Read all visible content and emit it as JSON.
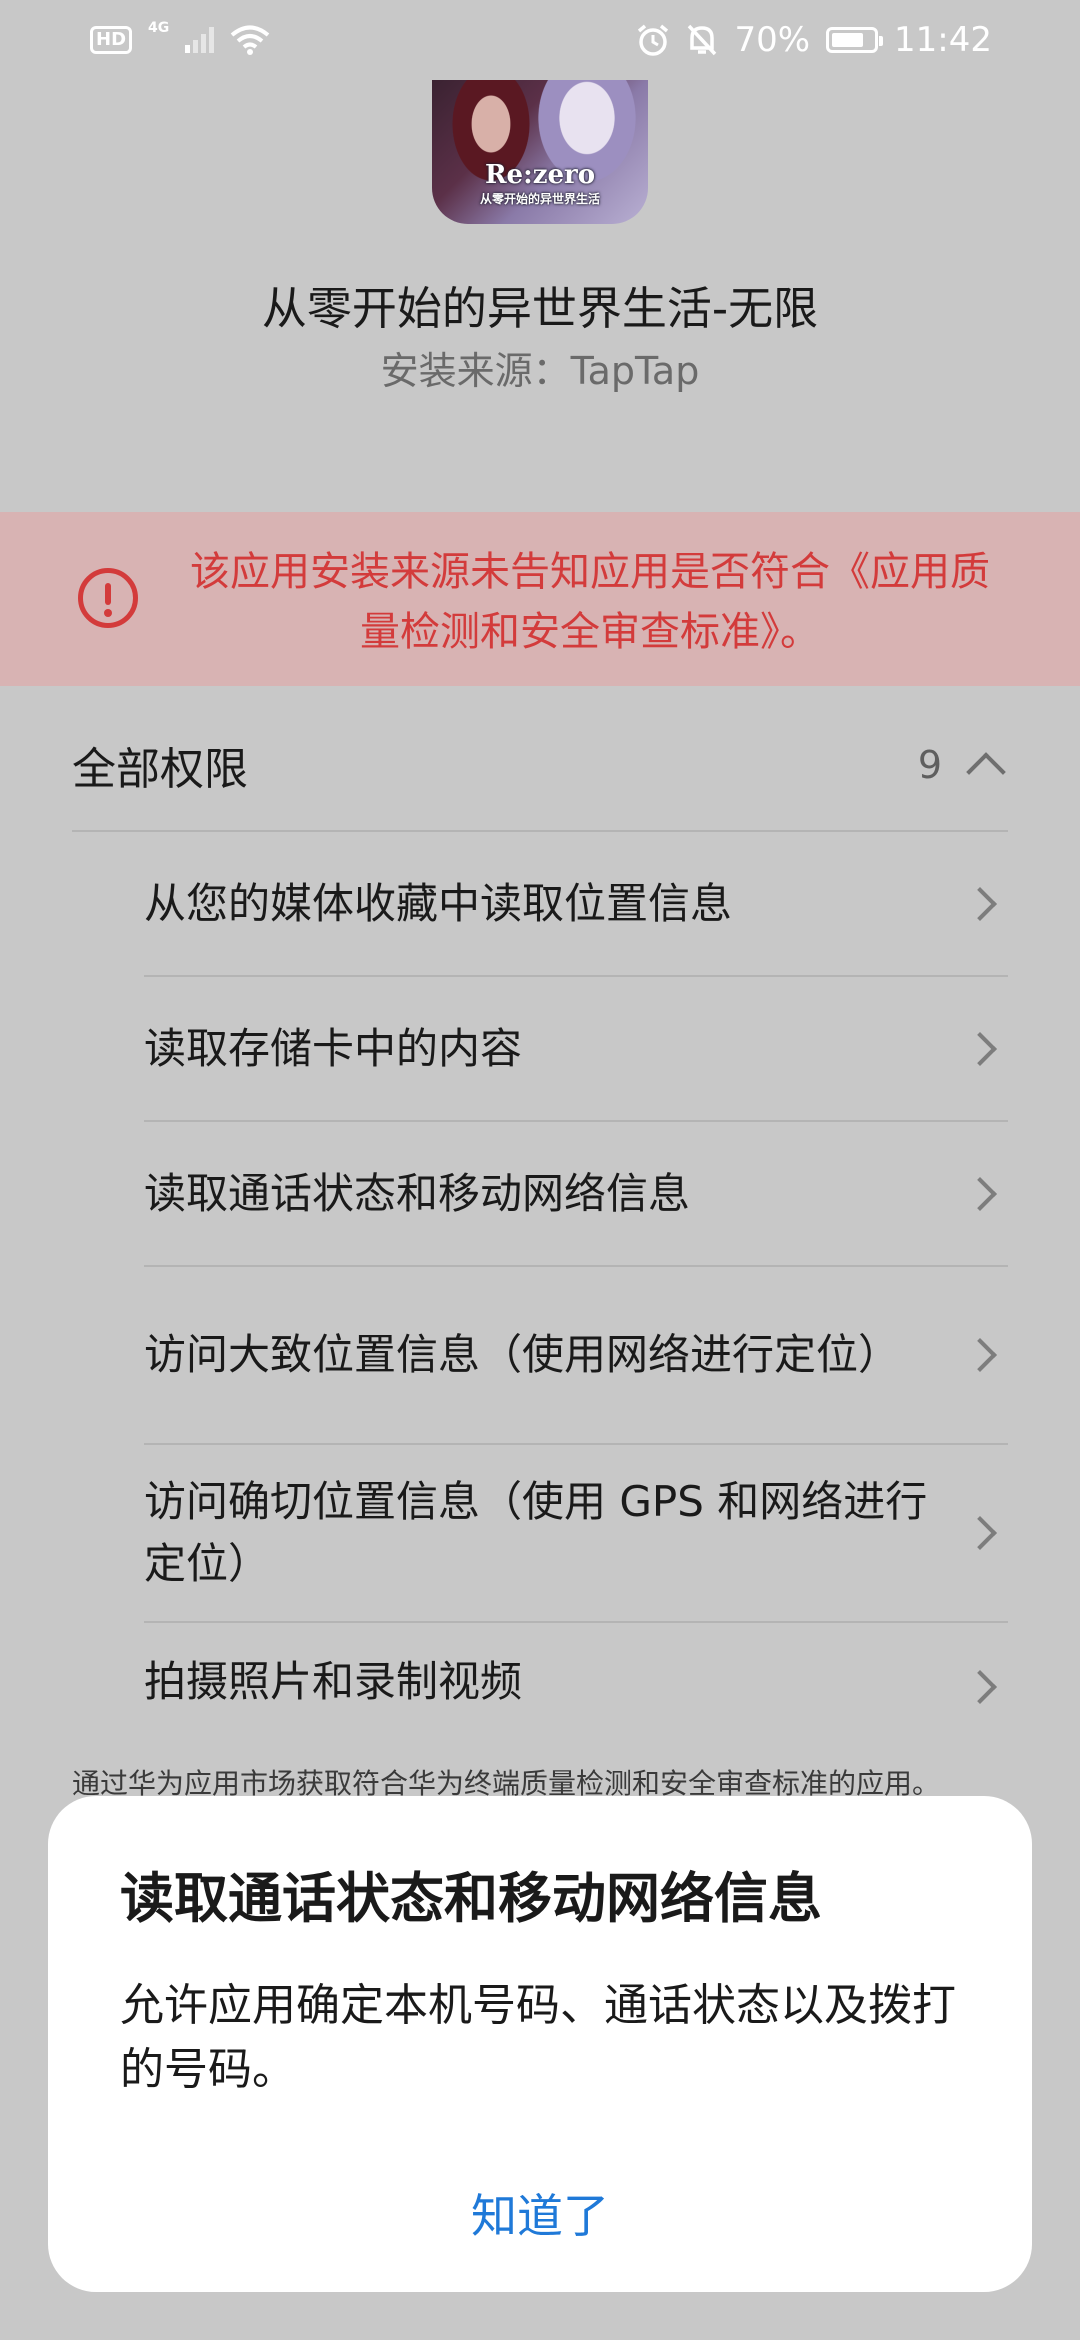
{
  "status_bar": {
    "hd": "HD",
    "network": "4G",
    "battery": "70%",
    "time": "11:42",
    "icons": [
      "hd-icon",
      "signal-icon",
      "wifi-icon",
      "alarm-icon",
      "mute-icon",
      "battery-icon"
    ]
  },
  "app": {
    "logo_text": "Re:zero",
    "logo_sub": "从零开始的异世界生活",
    "name": "从零开始的异世界生活-无限",
    "source": "安装来源：TapTap"
  },
  "warning": {
    "text": "该应用安装来源未告知应用是否符合《应用质量检测和安全审查标准》。",
    "color": "#d33b3b"
  },
  "permissions": {
    "title": "全部权限",
    "count": "9",
    "items": [
      "从您的媒体收藏中读取位置信息",
      "读取存储卡中的内容",
      "读取通话状态和移动网络信息",
      "访问大致位置信息（使用网络进行定位）",
      "访问确切位置信息（使用 GPS 和网络进行定位）",
      "拍摄照片和录制视频"
    ]
  },
  "footnote": "通过华为应用市场获取符合华为终端质量检测和安全审查标准的应用。",
  "dialog": {
    "title": "读取通话状态和移动网络信息",
    "body": "允许应用确定本机号码、通话状态以及拨打的号码。",
    "button": "知道了",
    "button_color": "#1f79d8"
  }
}
